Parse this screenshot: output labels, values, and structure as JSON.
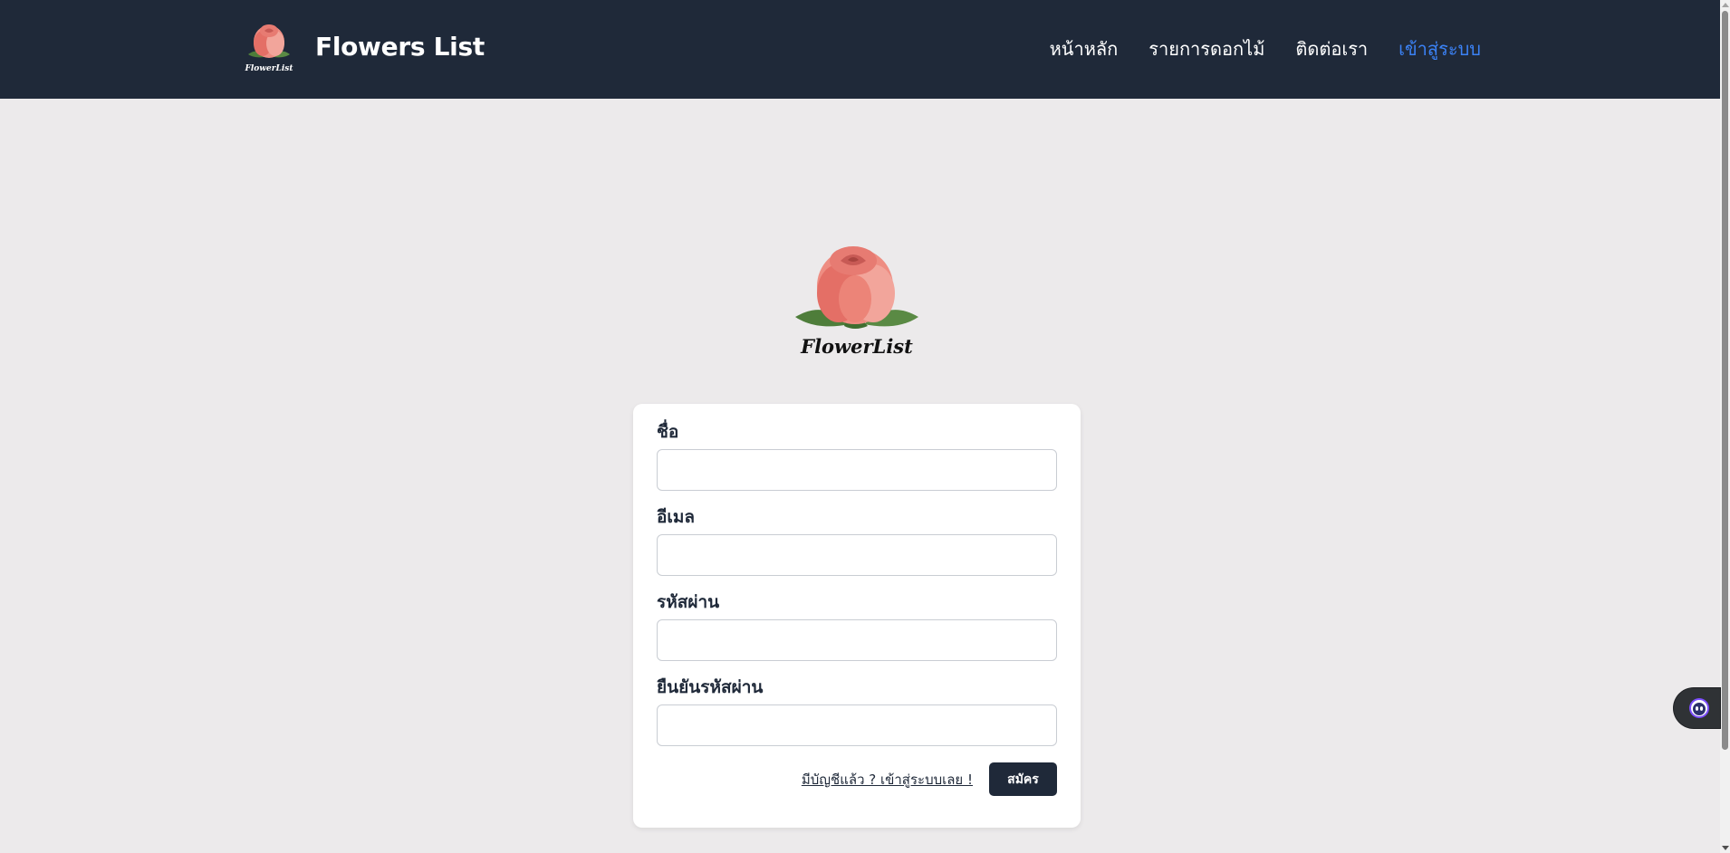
{
  "brand": {
    "title": "Flowers List",
    "logo_text": "FlowerList"
  },
  "nav": {
    "items": [
      {
        "label": "หน้าหลัก",
        "active": false
      },
      {
        "label": "รายการดอกไม้",
        "active": false
      },
      {
        "label": "ติดต่อเรา",
        "active": false
      },
      {
        "label": "เข้าสู่ระบบ",
        "active": true
      }
    ]
  },
  "hero": {
    "logo_text": "FlowerList"
  },
  "form": {
    "fields": [
      {
        "label": "ชื่อ",
        "value": "",
        "placeholder": ""
      },
      {
        "label": "อีเมล",
        "value": "",
        "placeholder": ""
      },
      {
        "label": "รหัสผ่าน",
        "value": "",
        "placeholder": ""
      },
      {
        "label": "ยืนยันรหัสผ่าน",
        "value": "",
        "placeholder": ""
      }
    ],
    "login_link": "มีบัญชีแล้ว ? เข้าสู่ระบบเลย !",
    "submit_label": "สมัคร"
  },
  "icons": {
    "brand_logo": "rose-logo-icon",
    "hero_logo": "rose-logo-icon",
    "assistant": "assistant-face-icon"
  },
  "colors": {
    "navbar_bg": "#1F2939",
    "page_bg": "#ECEAEB",
    "accent": "#3B82F6",
    "button_bg": "#1F2939"
  }
}
